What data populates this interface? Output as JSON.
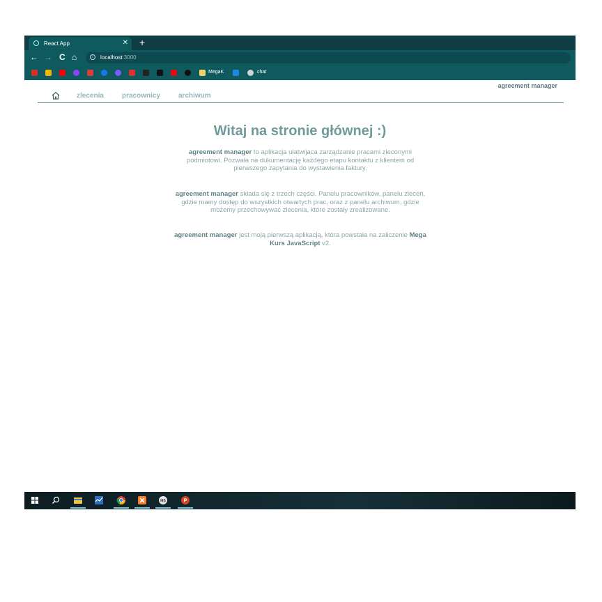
{
  "browser": {
    "tab_title": "React App",
    "tab_close": "✕",
    "new_tab": "+",
    "back": "←",
    "forward": "→",
    "reload": "C",
    "home": "⌂",
    "info": "i",
    "url_host": "localhost",
    "url_port": ":3000",
    "bookmarks": [
      {
        "icon": "gmail-icon",
        "color": "#d93025"
      },
      {
        "icon": "drive-icon",
        "color": "#f4b400"
      },
      {
        "icon": "youtube-icon",
        "color": "#ff0000"
      },
      {
        "icon": "podcast-icon",
        "color": "#8e44ff"
      },
      {
        "icon": "flag-icon",
        "color": "#e23b3b"
      },
      {
        "icon": "facebook-icon",
        "color": "#1877f2"
      },
      {
        "icon": "messenger-icon",
        "color": "#7a5cff"
      },
      {
        "icon": "k-icon",
        "color": "#e03030"
      },
      {
        "icon": "app-icon",
        "color": "#222222"
      },
      {
        "icon": "spark-icon",
        "color": "#111111"
      },
      {
        "icon": "netflix-icon",
        "color": "#e50914"
      },
      {
        "icon": "github-icon",
        "color": "#111111"
      }
    ],
    "bookmark_megak": "MegaK",
    "bookmark_chat": "chat"
  },
  "app": {
    "brand": "agreement manager",
    "nav": {
      "home_icon": "home-icon",
      "zlecenia": "zlecenia",
      "pracownicy": "pracownicy",
      "archiwum": "archiwum"
    },
    "heading": "Witaj na stronie głównej :)",
    "p1_bold": "agreement manager",
    "p1_text": " to aplikacja ułatwijaca zarządzanie pracami zleconymi podmiotowi. Pozwala na dukumentację każdego etapu kontaktu z klientem od pierwszego zapytania do wystawienia faktury.",
    "p2_bold": "agreement manager",
    "p2_text": " składa się z trzech części. Panelu pracowników, panelu zleceń, gdzie mamy dostęp do wszystkich otwartych prac, oraz z panelu archiwum, gdzie możemy przechowywać zlecenia, które zostały zrealizowane.",
    "p3_bold": "agreement manager",
    "p3_text": " jest moją pierwszą aplikacją, która powstała na zaliczenie ",
    "p3_bold2": "Mega Kurs JavaScript",
    "p3_tail": " v2."
  },
  "colors": {
    "browser_frame": "#0f5a5e",
    "accent_text": "#6f9a9c",
    "nav_link": "#95b7b9"
  },
  "taskbar": {
    "items": [
      "windows-start-icon",
      "search-icon",
      "file-explorer-icon",
      "task-manager-icon",
      "chrome-icon",
      "xampp-icon",
      "html5-icon",
      "powerpoint-icon"
    ]
  }
}
